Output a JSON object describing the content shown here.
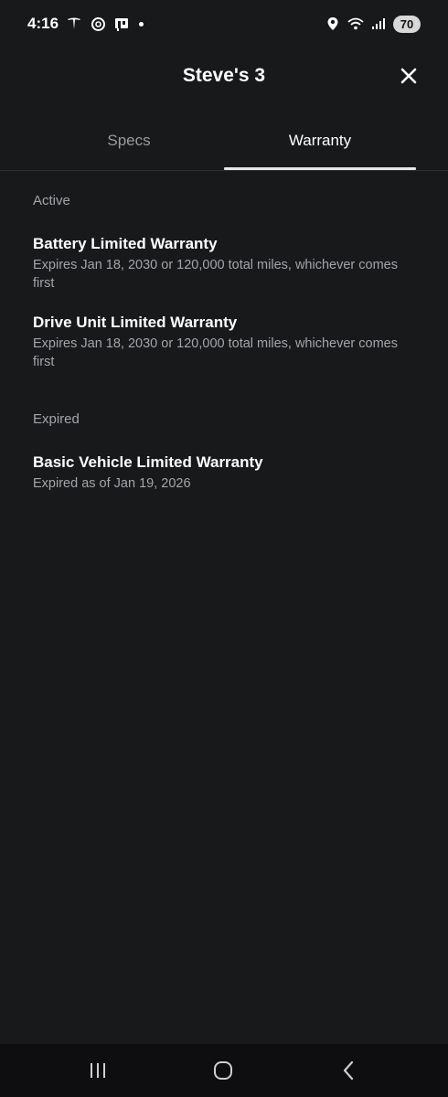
{
  "status_bar": {
    "time": "4:16",
    "battery": "70",
    "icons": [
      "tesla-icon",
      "openai-icon",
      "store-icon",
      "location-icon",
      "wifi-icon",
      "signal-icon"
    ]
  },
  "header": {
    "title": "Steve's 3",
    "close_icon": "close-icon"
  },
  "tabs": [
    {
      "label": "Specs",
      "selected": false
    },
    {
      "label": "Warranty",
      "selected": true
    }
  ],
  "sections": {
    "active": {
      "label": "Active",
      "items": [
        {
          "title": "Battery Limited Warranty",
          "subtitle": "Expires Jan 18, 2030 or 120,000 total miles, whichever comes first"
        },
        {
          "title": "Drive Unit Limited Warranty",
          "subtitle": "Expires Jan 18, 2030 or 120,000 total miles, whichever comes first"
        }
      ]
    },
    "expired": {
      "label": "Expired",
      "items": [
        {
          "title": "Basic Vehicle Limited Warranty",
          "subtitle": "Expired as of Jan 19, 2026"
        }
      ]
    }
  },
  "nav_bar": {
    "icons": [
      "recents-icon",
      "home-icon",
      "back-icon"
    ]
  },
  "colors": {
    "background": "#18191b",
    "text_primary": "#ffffff",
    "text_secondary": "#a4a5aa",
    "tab_indicator": "#e6e6e6"
  }
}
